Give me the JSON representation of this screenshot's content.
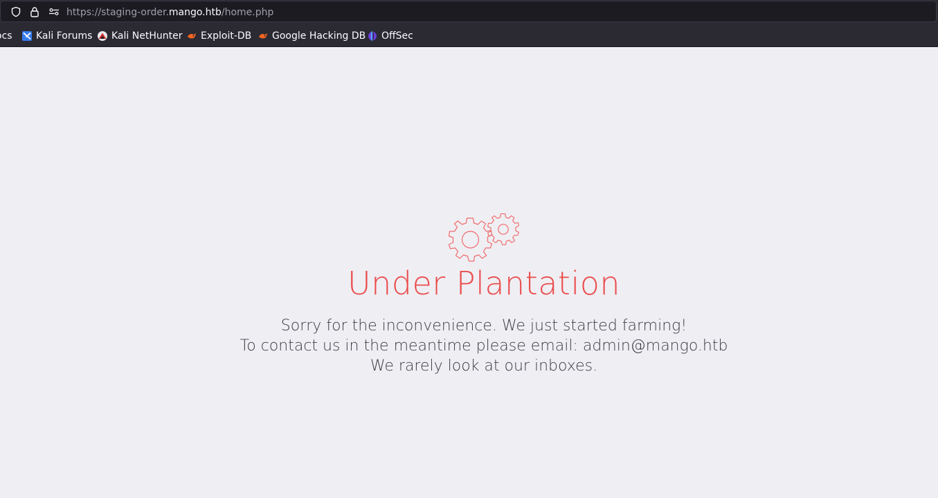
{
  "browser": {
    "url_scheme": "https://staging-order.",
    "url_host": "mango.htb",
    "url_path": "/home.php",
    "icons": [
      "shield-icon",
      "lock-icon",
      "permissions-icon"
    ]
  },
  "bookmarks": [
    {
      "label": "ocs",
      "icon": "none"
    },
    {
      "label": "Kali Forums",
      "icon": "kali-forums-icon"
    },
    {
      "label": "Kali NetHunter",
      "icon": "kali-nethunter-icon"
    },
    {
      "label": "Exploit-DB",
      "icon": "exploit-db-icon"
    },
    {
      "label": "Google Hacking DB",
      "icon": "ghdb-icon"
    },
    {
      "label": "OffSec",
      "icon": "offsec-icon"
    }
  ],
  "page": {
    "icon": "gears-icon",
    "heading": "Under Plantation",
    "lines": [
      "Sorry for the inconvenience. We just started farming!",
      "To contact us in the meantime please email: admin@mango.htb",
      "We rarely look at our inboxes."
    ]
  },
  "colors": {
    "accent": "#ea4c4c",
    "page_background": "#efeef3",
    "text": "#3c3c44",
    "toolbar": "#2b2a33",
    "urlbar": "#1c1b22"
  }
}
